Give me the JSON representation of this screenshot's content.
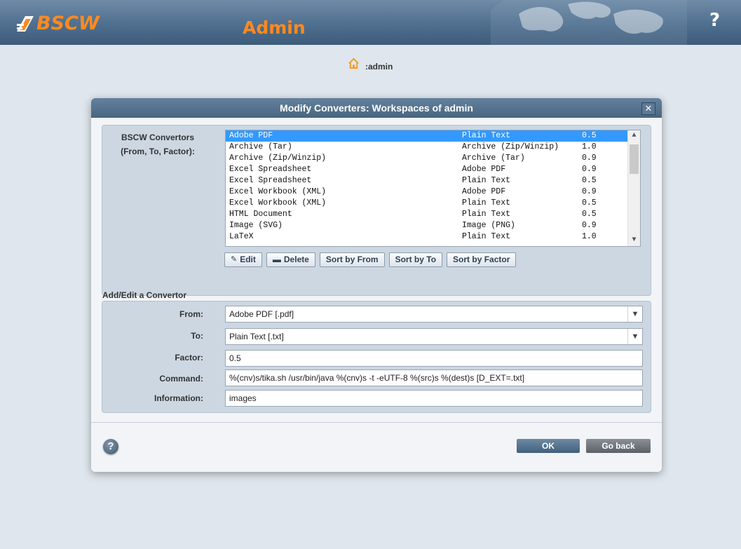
{
  "header": {
    "logo_text": "BSCW",
    "app_title": "Admin",
    "help_symbol": "?",
    "brand_color": "#ff8a1d"
  },
  "breadcrumb": {
    "icon": "home-icon",
    "text": ":admin"
  },
  "dialog": {
    "title": "Modify Converters: Workspaces of admin",
    "close_symbol": "✕",
    "converters_label_line1": "BSCW Convertors",
    "converters_label_line2": "(From, To, Factor):",
    "converters": [
      {
        "from": "Adobe PDF",
        "to": "Plain Text",
        "factor": "0.5",
        "selected": true
      },
      {
        "from": "Archive (Tar)",
        "to": "Archive (Zip/Winzip)",
        "factor": "1.0"
      },
      {
        "from": "Archive (Zip/Winzip)",
        "to": "Archive (Tar)",
        "factor": "0.9"
      },
      {
        "from": "Excel Spreadsheet",
        "to": "Adobe PDF",
        "factor": "0.9"
      },
      {
        "from": "Excel Spreadsheet",
        "to": "Plain Text",
        "factor": "0.5"
      },
      {
        "from": "Excel Workbook (XML)",
        "to": "Adobe PDF",
        "factor": "0.9"
      },
      {
        "from": "Excel Workbook (XML)",
        "to": "Plain Text",
        "factor": "0.5"
      },
      {
        "from": "HTML Document",
        "to": "Plain Text",
        "factor": "0.5"
      },
      {
        "from": "Image (SVG)",
        "to": "Image (PNG)",
        "factor": "0.9"
      },
      {
        "from": "LaTeX",
        "to": "Plain Text",
        "factor": "1.0"
      }
    ],
    "buttons": {
      "edit": "Edit",
      "delete": "Delete",
      "sort_from": "Sort by From",
      "sort_to": "Sort by To",
      "sort_factor": "Sort by Factor"
    },
    "add_edit_title": "Add/Edit a Convertor",
    "form": {
      "from_label": "From:",
      "from_value": "Adobe PDF [.pdf]",
      "to_label": "To:",
      "to_value": "Plain Text [.txt]",
      "factor_label": "Factor:",
      "factor_value": "0.5",
      "command_label": "Command:",
      "command_value": "%(cnv)s/tika.sh /usr/bin/java %(cnv)s -t -eUTF-8 %(src)s %(dest)s [D_EXT=.txt]",
      "information_label": "Information:",
      "information_value": "images"
    },
    "help_symbol": "?",
    "ok_label": "OK",
    "back_label": "Go back"
  }
}
